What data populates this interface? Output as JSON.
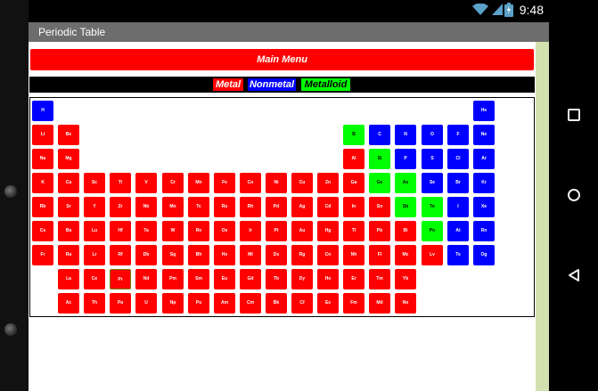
{
  "status_bar": {
    "time": "9:48",
    "icons": [
      "wifi-icon",
      "signal-icon",
      "battery-icon"
    ]
  },
  "app": {
    "title": "Periodic Table"
  },
  "main_menu": {
    "label": "Main Menu"
  },
  "legend": {
    "metal": "Metal",
    "nonmetal": "Nonmetal",
    "metalloid": "Metalloid"
  },
  "colors": {
    "metal": "#ff0000",
    "nonmetal": "#0000ff",
    "metalloid": "#00ff00",
    "title_bar": "#6d6d6d",
    "scroll_strip": "#d3e0b0"
  },
  "navigation_bar": [
    "square-icon",
    "circle-icon",
    "triangle-back-icon"
  ],
  "elements": [
    {
      "symbol": "H",
      "row": 1,
      "col": 1,
      "type": "nonmetal"
    },
    {
      "symbol": "He",
      "row": 1,
      "col": 18,
      "type": "nonmetal"
    },
    {
      "symbol": "Li",
      "row": 2,
      "col": 1,
      "type": "metal"
    },
    {
      "symbol": "Be",
      "row": 2,
      "col": 2,
      "type": "metal"
    },
    {
      "symbol": "B",
      "row": 2,
      "col": 13,
      "type": "metalloid"
    },
    {
      "symbol": "C",
      "row": 2,
      "col": 14,
      "type": "nonmetal"
    },
    {
      "symbol": "N",
      "row": 2,
      "col": 15,
      "type": "nonmetal"
    },
    {
      "symbol": "O",
      "row": 2,
      "col": 16,
      "type": "nonmetal"
    },
    {
      "symbol": "F",
      "row": 2,
      "col": 17,
      "type": "nonmetal"
    },
    {
      "symbol": "Ne",
      "row": 2,
      "col": 18,
      "type": "nonmetal"
    },
    {
      "symbol": "Na",
      "row": 3,
      "col": 1,
      "type": "metal"
    },
    {
      "symbol": "Mg",
      "row": 3,
      "col": 2,
      "type": "metal"
    },
    {
      "symbol": "Al",
      "row": 3,
      "col": 13,
      "type": "metal"
    },
    {
      "symbol": "Si",
      "row": 3,
      "col": 14,
      "type": "metalloid"
    },
    {
      "symbol": "P",
      "row": 3,
      "col": 15,
      "type": "nonmetal"
    },
    {
      "symbol": "S",
      "row": 3,
      "col": 16,
      "type": "nonmetal"
    },
    {
      "symbol": "Cl",
      "row": 3,
      "col": 17,
      "type": "nonmetal"
    },
    {
      "symbol": "Ar",
      "row": 3,
      "col": 18,
      "type": "nonmetal"
    },
    {
      "symbol": "K",
      "row": 4,
      "col": 1,
      "type": "metal"
    },
    {
      "symbol": "Ca",
      "row": 4,
      "col": 2,
      "type": "metal"
    },
    {
      "symbol": "Sc",
      "row": 4,
      "col": 3,
      "type": "metal"
    },
    {
      "symbol": "Ti",
      "row": 4,
      "col": 4,
      "type": "metal"
    },
    {
      "symbol": "V",
      "row": 4,
      "col": 5,
      "type": "metal"
    },
    {
      "symbol": "Cr",
      "row": 4,
      "col": 6,
      "type": "metal"
    },
    {
      "symbol": "Mn",
      "row": 4,
      "col": 7,
      "type": "metal"
    },
    {
      "symbol": "Fe",
      "row": 4,
      "col": 8,
      "type": "metal"
    },
    {
      "symbol": "Co",
      "row": 4,
      "col": 9,
      "type": "metal"
    },
    {
      "symbol": "Ni",
      "row": 4,
      "col": 10,
      "type": "metal"
    },
    {
      "symbol": "Cu",
      "row": 4,
      "col": 11,
      "type": "metal"
    },
    {
      "symbol": "Zn",
      "row": 4,
      "col": 12,
      "type": "metal"
    },
    {
      "symbol": "Ga",
      "row": 4,
      "col": 13,
      "type": "metal"
    },
    {
      "symbol": "Ge",
      "row": 4,
      "col": 14,
      "type": "metalloid"
    },
    {
      "symbol": "As",
      "row": 4,
      "col": 15,
      "type": "metalloid"
    },
    {
      "symbol": "Se",
      "row": 4,
      "col": 16,
      "type": "nonmetal"
    },
    {
      "symbol": "Br",
      "row": 4,
      "col": 17,
      "type": "nonmetal"
    },
    {
      "symbol": "Kr",
      "row": 4,
      "col": 18,
      "type": "nonmetal"
    },
    {
      "symbol": "Rb",
      "row": 5,
      "col": 1,
      "type": "metal"
    },
    {
      "symbol": "Sr",
      "row": 5,
      "col": 2,
      "type": "metal"
    },
    {
      "symbol": "Y",
      "row": 5,
      "col": 3,
      "type": "metal"
    },
    {
      "symbol": "Zr",
      "row": 5,
      "col": 4,
      "type": "metal"
    },
    {
      "symbol": "Nb",
      "row": 5,
      "col": 5,
      "type": "metal"
    },
    {
      "symbol": "Mo",
      "row": 5,
      "col": 6,
      "type": "metal"
    },
    {
      "symbol": "Tc",
      "row": 5,
      "col": 7,
      "type": "metal"
    },
    {
      "symbol": "Ru",
      "row": 5,
      "col": 8,
      "type": "metal"
    },
    {
      "symbol": "Rh",
      "row": 5,
      "col": 9,
      "type": "metal"
    },
    {
      "symbol": "Pd",
      "row": 5,
      "col": 10,
      "type": "metal"
    },
    {
      "symbol": "Ag",
      "row": 5,
      "col": 11,
      "type": "metal"
    },
    {
      "symbol": "Cd",
      "row": 5,
      "col": 12,
      "type": "metal"
    },
    {
      "symbol": "In",
      "row": 5,
      "col": 13,
      "type": "metal"
    },
    {
      "symbol": "Sn",
      "row": 5,
      "col": 14,
      "type": "metal"
    },
    {
      "symbol": "Sb",
      "row": 5,
      "col": 15,
      "type": "metalloid"
    },
    {
      "symbol": "Te",
      "row": 5,
      "col": 16,
      "type": "metalloid"
    },
    {
      "symbol": "I",
      "row": 5,
      "col": 17,
      "type": "nonmetal"
    },
    {
      "symbol": "Xe",
      "row": 5,
      "col": 18,
      "type": "nonmetal"
    },
    {
      "symbol": "Cs",
      "row": 6,
      "col": 1,
      "type": "metal"
    },
    {
      "symbol": "Ba",
      "row": 6,
      "col": 2,
      "type": "metal"
    },
    {
      "symbol": "Lu",
      "row": 6,
      "col": 3,
      "type": "metal"
    },
    {
      "symbol": "Hf",
      "row": 6,
      "col": 4,
      "type": "metal"
    },
    {
      "symbol": "Ta",
      "row": 6,
      "col": 5,
      "type": "metal"
    },
    {
      "symbol": "W",
      "row": 6,
      "col": 6,
      "type": "metal"
    },
    {
      "symbol": "Re",
      "row": 6,
      "col": 7,
      "type": "metal"
    },
    {
      "symbol": "Os",
      "row": 6,
      "col": 8,
      "type": "metal"
    },
    {
      "symbol": "Ir",
      "row": 6,
      "col": 9,
      "type": "metal"
    },
    {
      "symbol": "Pt",
      "row": 6,
      "col": 10,
      "type": "metal"
    },
    {
      "symbol": "Au",
      "row": 6,
      "col": 11,
      "type": "metal"
    },
    {
      "symbol": "Hg",
      "row": 6,
      "col": 12,
      "type": "metal"
    },
    {
      "symbol": "Tl",
      "row": 6,
      "col": 13,
      "type": "metal"
    },
    {
      "symbol": "Pb",
      "row": 6,
      "col": 14,
      "type": "metal"
    },
    {
      "symbol": "Bi",
      "row": 6,
      "col": 15,
      "type": "metal"
    },
    {
      "symbol": "Po",
      "row": 6,
      "col": 16,
      "type": "metalloid"
    },
    {
      "symbol": "At",
      "row": 6,
      "col": 17,
      "type": "nonmetal"
    },
    {
      "symbol": "Rn",
      "row": 6,
      "col": 18,
      "type": "nonmetal"
    },
    {
      "symbol": "Fr",
      "row": 7,
      "col": 1,
      "type": "metal"
    },
    {
      "symbol": "Ra",
      "row": 7,
      "col": 2,
      "type": "metal"
    },
    {
      "symbol": "Lr",
      "row": 7,
      "col": 3,
      "type": "metal"
    },
    {
      "symbol": "Rf",
      "row": 7,
      "col": 4,
      "type": "metal"
    },
    {
      "symbol": "Db",
      "row": 7,
      "col": 5,
      "type": "metal"
    },
    {
      "symbol": "Sg",
      "row": 7,
      "col": 6,
      "type": "metal"
    },
    {
      "symbol": "Bh",
      "row": 7,
      "col": 7,
      "type": "metal"
    },
    {
      "symbol": "Hs",
      "row": 7,
      "col": 8,
      "type": "metal"
    },
    {
      "symbol": "Mt",
      "row": 7,
      "col": 9,
      "type": "metal"
    },
    {
      "symbol": "Ds",
      "row": 7,
      "col": 10,
      "type": "metal"
    },
    {
      "symbol": "Rg",
      "row": 7,
      "col": 11,
      "type": "metal"
    },
    {
      "symbol": "Cn",
      "row": 7,
      "col": 12,
      "type": "metal"
    },
    {
      "symbol": "Nh",
      "row": 7,
      "col": 13,
      "type": "metal"
    },
    {
      "symbol": "Fl",
      "row": 7,
      "col": 14,
      "type": "metal"
    },
    {
      "symbol": "Mc",
      "row": 7,
      "col": 15,
      "type": "metal"
    },
    {
      "symbol": "Lv",
      "row": 7,
      "col": 16,
      "type": "metal"
    },
    {
      "symbol": "Ts",
      "row": 7,
      "col": 17,
      "type": "nonmetal"
    },
    {
      "symbol": "Og",
      "row": 7,
      "col": 18,
      "type": "nonmetal"
    },
    {
      "symbol": "La",
      "row": 8,
      "col": 2,
      "type": "metal"
    },
    {
      "symbol": "Ce",
      "row": 8,
      "col": 3,
      "type": "metal"
    },
    {
      "symbol": "Pr",
      "row": 8,
      "col": 4,
      "type": "metal",
      "selected": true
    },
    {
      "symbol": "Nd",
      "row": 8,
      "col": 5,
      "type": "metal"
    },
    {
      "symbol": "Pm",
      "row": 8,
      "col": 6,
      "type": "metal"
    },
    {
      "symbol": "Sm",
      "row": 8,
      "col": 7,
      "type": "metal"
    },
    {
      "symbol": "Eu",
      "row": 8,
      "col": 8,
      "type": "metal"
    },
    {
      "symbol": "Gd",
      "row": 8,
      "col": 9,
      "type": "metal"
    },
    {
      "symbol": "Tb",
      "row": 8,
      "col": 10,
      "type": "metal"
    },
    {
      "symbol": "Dy",
      "row": 8,
      "col": 11,
      "type": "metal"
    },
    {
      "symbol": "Ho",
      "row": 8,
      "col": 12,
      "type": "metal"
    },
    {
      "symbol": "Er",
      "row": 8,
      "col": 13,
      "type": "metal"
    },
    {
      "symbol": "Tm",
      "row": 8,
      "col": 14,
      "type": "metal"
    },
    {
      "symbol": "Yb",
      "row": 8,
      "col": 15,
      "type": "metal"
    },
    {
      "symbol": "Ac",
      "row": 9,
      "col": 2,
      "type": "metal"
    },
    {
      "symbol": "Th",
      "row": 9,
      "col": 3,
      "type": "metal"
    },
    {
      "symbol": "Pa",
      "row": 9,
      "col": 4,
      "type": "metal"
    },
    {
      "symbol": "U",
      "row": 9,
      "col": 5,
      "type": "metal"
    },
    {
      "symbol": "Np",
      "row": 9,
      "col": 6,
      "type": "metal"
    },
    {
      "symbol": "Pu",
      "row": 9,
      "col": 7,
      "type": "metal"
    },
    {
      "symbol": "Am",
      "row": 9,
      "col": 8,
      "type": "metal"
    },
    {
      "symbol": "Cm",
      "row": 9,
      "col": 9,
      "type": "metal"
    },
    {
      "symbol": "Bk",
      "row": 9,
      "col": 10,
      "type": "metal"
    },
    {
      "symbol": "Cf",
      "row": 9,
      "col": 11,
      "type": "metal"
    },
    {
      "symbol": "Es",
      "row": 9,
      "col": 12,
      "type": "metal"
    },
    {
      "symbol": "Fm",
      "row": 9,
      "col": 13,
      "type": "metal"
    },
    {
      "symbol": "Md",
      "row": 9,
      "col": 14,
      "type": "metal"
    },
    {
      "symbol": "No",
      "row": 9,
      "col": 15,
      "type": "metal"
    }
  ]
}
